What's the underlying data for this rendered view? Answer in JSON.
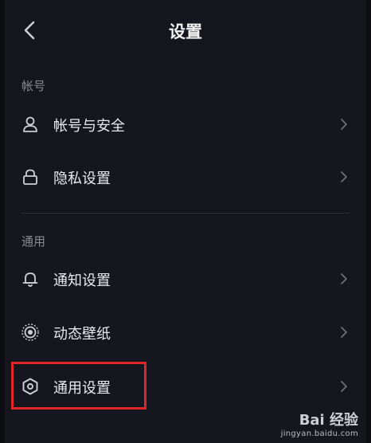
{
  "header": {
    "title": "设置",
    "back_icon": "chevron-left-icon"
  },
  "sections": [
    {
      "label": "帐号",
      "items": [
        {
          "label": "帐号与安全",
          "icon": "user-icon"
        },
        {
          "label": "隐私设置",
          "icon": "lock-icon"
        }
      ]
    },
    {
      "label": "通用",
      "items": [
        {
          "label": "通知设置",
          "icon": "bell-icon"
        },
        {
          "label": "动态壁纸",
          "icon": "wallpaper-icon"
        },
        {
          "label": "通用设置",
          "icon": "hexagon-settings-icon"
        }
      ]
    }
  ],
  "watermark": {
    "logo": "Bai 经验",
    "url": "jingyan.baidu.com"
  },
  "colors": {
    "background": "#16161e",
    "highlight": "#e0262a",
    "text": "#e9e9ee",
    "muted": "#8b8b94"
  }
}
